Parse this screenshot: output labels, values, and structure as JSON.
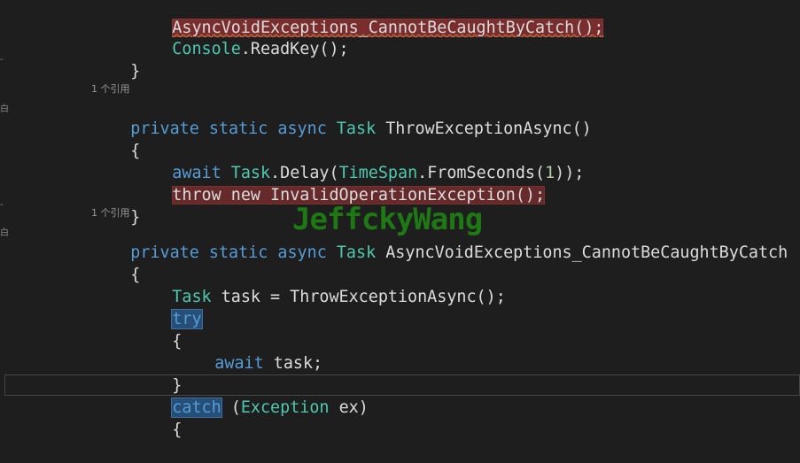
{
  "code": {
    "l1_call": "AsyncVoidExceptions_CannotBeCaughtByCatch();",
    "l2_console": "Console",
    "l2_rest": ".ReadKey();",
    "brace_close": "}",
    "brace_open": "{",
    "lens1": "1 个引用",
    "m1_private": "private",
    "m1_static": "static",
    "m1_async": "async",
    "m1_task": "Task",
    "m1_name": "ThrowExceptionAsync()",
    "l_await": "await",
    "l_task2": "Task",
    "l_delay": ".Delay(",
    "l_timespan": "TimeSpan",
    "l_fromseconds": ".FromSeconds(",
    "l_one": "1",
    "l_delay_end": "));",
    "l_throw": "throw",
    "l_new": "new",
    "l_invalid": "InvalidOperationException();",
    "lens2": "1 个引用",
    "m2_private": "private",
    "m2_static": "static",
    "m2_async": "async",
    "m2_task": "Task",
    "m2_name": "AsyncVoidExceptions_CannotBeCaughtByCatch",
    "l_task3": "Task",
    "l_taskvar": "task = ThrowExceptionAsync();",
    "l_try": "try",
    "l_await2": "await",
    "l_await2_rest": "task;",
    "l_catch": "catch",
    "l_catch_open": "(",
    "l_exception": "Exception",
    "l_catch_rest": "ex)"
  },
  "watermark": "JeffckyWang",
  "gutter": {
    "mark_minus": "-",
    "mark_fold": "白"
  }
}
